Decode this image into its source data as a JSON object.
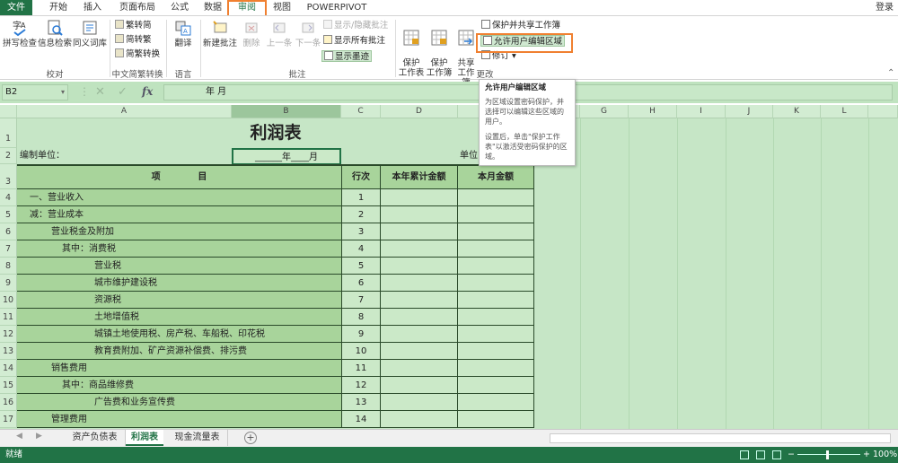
{
  "ribbon_tabs": {
    "file": "文件",
    "home": "开始",
    "insert": "插入",
    "page_layout": "页面布局",
    "formulas": "公式",
    "data": "数据",
    "review": "审阅",
    "view": "视图",
    "powerpivot": "POWERPIVOT",
    "login": "登录"
  },
  "groups": {
    "proofing": {
      "name": "校对",
      "spelling": "拼写检查",
      "research": "信息检索",
      "thesaurus": "同义词库"
    },
    "chinese": {
      "name": "中文简繁转换",
      "to_simplified": "繁转简",
      "to_traditional": "简转繁",
      "convert": "简繁转换"
    },
    "language": {
      "name": "语言",
      "translate": "翻译"
    },
    "comments": {
      "name": "批注",
      "new": "新建批注",
      "delete": "删除",
      "prev": "上一条",
      "next": "下一条",
      "show_hide": "显示/隐藏批注",
      "show_all": "显示所有批注",
      "show_ink": "显示墨迹"
    },
    "changes": {
      "name": "更改",
      "protect_sheet": "保护\n工作表",
      "protect_workbook": "保护\n工作簿",
      "share_workbook": "共享\n工作簿",
      "protect_share": "保护并共享工作簿",
      "allow_edit": "允许用户编辑区域",
      "track": "修订"
    }
  },
  "formula_bar": {
    "name_box": "B2",
    "fx": "fx",
    "content": "年    月"
  },
  "columns": [
    "A",
    "B",
    "C",
    "D",
    "E",
    "F",
    "G",
    "H",
    "I",
    "J",
    "K",
    "L"
  ],
  "sheet": {
    "title": "利润表",
    "unit_label": "编制单位：",
    "date_cell": "______年____月",
    "unit_right": "单位",
    "headers": {
      "item": "项            目",
      "line": "行次",
      "ytd": "本年累计金额",
      "month": "本月金额"
    },
    "rows": [
      {
        "row": "4",
        "label": "一、营业收入",
        "line": "1",
        "indent": 0
      },
      {
        "row": "5",
        "label": "减：营业成本",
        "line": "2",
        "indent": 0
      },
      {
        "row": "6",
        "label": "营业税金及附加",
        "line": "3",
        "indent": 1
      },
      {
        "row": "7",
        "label": "其中：消费税",
        "line": "4",
        "indent": 2
      },
      {
        "row": "8",
        "label": "营业税",
        "line": "5",
        "indent": 3
      },
      {
        "row": "9",
        "label": "城市维护建设税",
        "line": "6",
        "indent": 3
      },
      {
        "row": "10",
        "label": "资源税",
        "line": "7",
        "indent": 3
      },
      {
        "row": "11",
        "label": "土地增值税",
        "line": "8",
        "indent": 3
      },
      {
        "row": "12",
        "label": "城镇土地使用税、房产税、车船税、印花税",
        "line": "9",
        "indent": 3
      },
      {
        "row": "13",
        "label": "教育费附加、矿产资源补偿费、排污费",
        "line": "10",
        "indent": 3
      },
      {
        "row": "14",
        "label": "销售费用",
        "line": "11",
        "indent": 1
      },
      {
        "row": "15",
        "label": "其中：商品维修费",
        "line": "12",
        "indent": 2
      },
      {
        "row": "16",
        "label": "广告费和业务宣传费",
        "line": "13",
        "indent": 3
      },
      {
        "row": "17",
        "label": "管理费用",
        "line": "14",
        "indent": 1
      }
    ]
  },
  "tooltip": {
    "title": "允许用户编辑区域",
    "text1": "为区域设置密码保护，并选择可以编辑这些区域的用户。",
    "text2": "设置后，单击\"保护工作表\"以激活受密码保护的区域。"
  },
  "sheet_tabs": [
    "资产负债表",
    "利润表",
    "现金流量表"
  ],
  "active_sheet": "利润表",
  "status": {
    "ready": "就绪",
    "zoom": "100%"
  },
  "colors": {
    "excel_green": "#217346",
    "highlight_orange": "#f08030",
    "cell_green": "#a8d49b"
  }
}
